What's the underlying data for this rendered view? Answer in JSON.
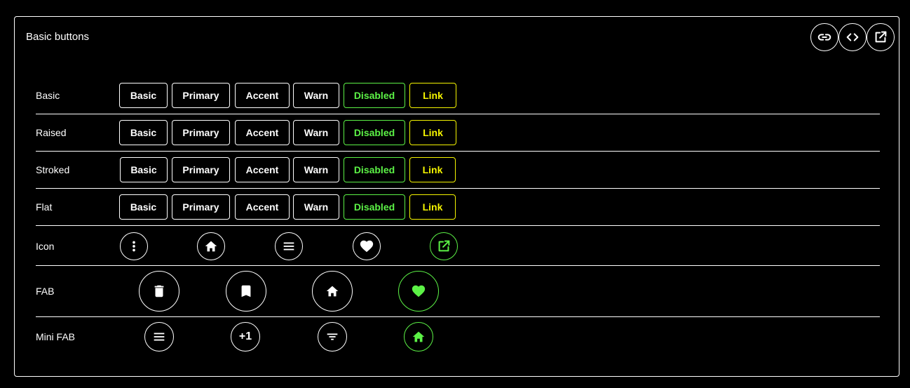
{
  "card": {
    "title": "Basic buttons",
    "actions": [
      {
        "icon": "link-icon"
      },
      {
        "icon": "code-icon"
      },
      {
        "icon": "open-in-new-icon"
      }
    ]
  },
  "text_rows": [
    {
      "label": "Basic",
      "buttons": [
        "Basic",
        "Primary",
        "Accent",
        "Warn",
        "Disabled",
        "Link"
      ]
    },
    {
      "label": "Raised",
      "buttons": [
        "Basic",
        "Primary",
        "Accent",
        "Warn",
        "Disabled",
        "Link"
      ]
    },
    {
      "label": "Stroked",
      "buttons": [
        "Basic",
        "Primary",
        "Accent",
        "Warn",
        "Disabled",
        "Link"
      ]
    },
    {
      "label": "Flat",
      "buttons": [
        "Basic",
        "Primary",
        "Accent",
        "Warn",
        "Disabled",
        "Link"
      ]
    }
  ],
  "icon_row": {
    "label": "Icon",
    "buttons": [
      "more-vert-icon",
      "home-icon",
      "menu-icon",
      "favorite-icon",
      "open-in-new-icon"
    ]
  },
  "fab_row": {
    "label": "FAB",
    "buttons": [
      "delete-icon",
      "bookmark-icon",
      "home-icon",
      "favorite-icon"
    ]
  },
  "mini_fab_row": {
    "label": "Mini FAB",
    "buttons": [
      "menu-icon",
      "plus-one",
      "filter-list-icon",
      "home-icon"
    ],
    "plus_one_text": "+1"
  },
  "colors": {
    "background": "#000000",
    "foreground": "#ffffff",
    "disabled": "#5cf246",
    "link": "#f5f500"
  }
}
